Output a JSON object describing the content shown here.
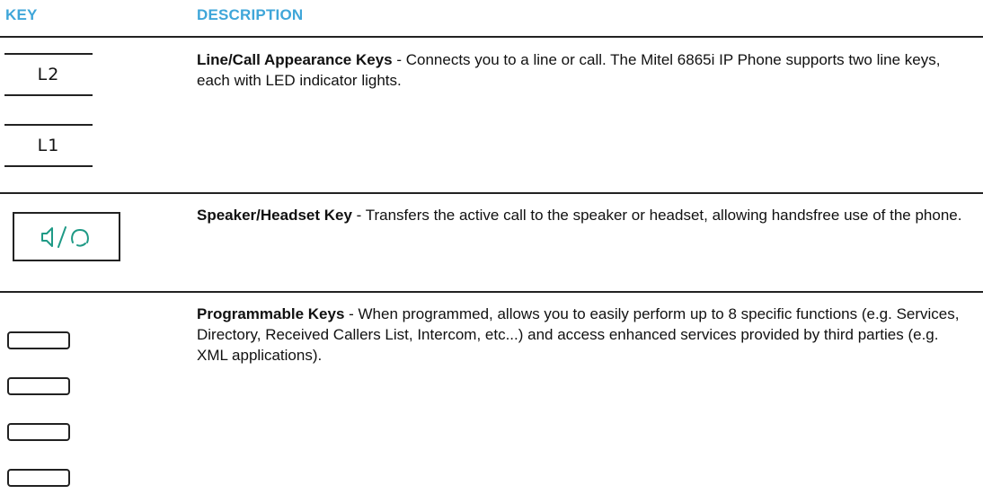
{
  "header": {
    "key": "KEY",
    "description": "DESCRIPTION"
  },
  "colors": {
    "header_text": "#3fa6d9",
    "speaker_icon": "#1f9a86",
    "rule": "#222222"
  },
  "rows": [
    {
      "keys": [
        "L2",
        "L1"
      ],
      "title": "Line/Call Appearance Keys",
      "text": " - Connects you to a line or call. The Mitel 6865i IP Phone supports two line keys, each with LED indicator lights."
    },
    {
      "icon": "speaker-headset-icon",
      "title": "Speaker/Headset Key",
      "text": " - Transfers the active call to the speaker or headset, allowing handsfree use of the phone."
    },
    {
      "key_count": 4,
      "title": "Programmable Keys",
      "text": " - When programmed, allows you to easily perform up to 8 specific functions (e.g. Services, Directory, Received Callers List, Intercom, etc...) and access enhanced services provided by third parties (e.g. XML applications)."
    }
  ]
}
